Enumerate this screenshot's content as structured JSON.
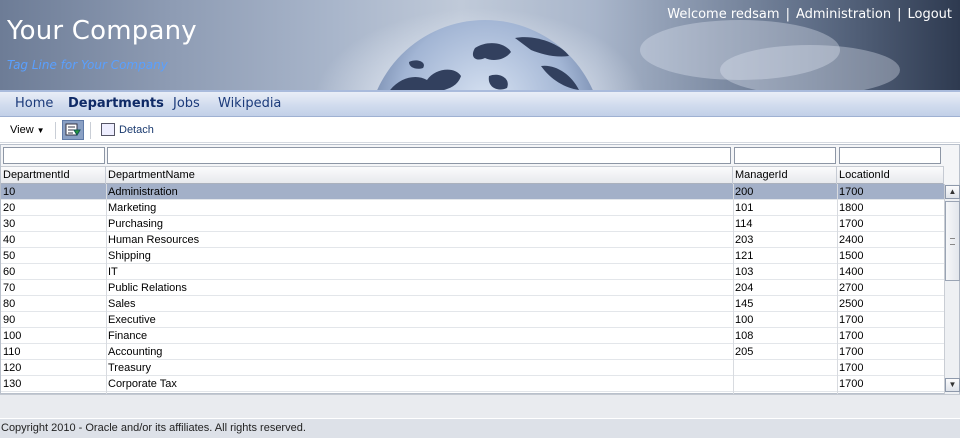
{
  "header": {
    "company_name": "Your Company",
    "tagline": "Tag Line for Your Company",
    "welcome": "Welcome redsam",
    "links": [
      "Administration",
      "Logout"
    ]
  },
  "nav": {
    "tabs": [
      {
        "label": "Home",
        "active": false
      },
      {
        "label": "Departments",
        "active": true
      },
      {
        "label": "Jobs",
        "active": false
      },
      {
        "label": "Wikipedia",
        "active": false
      }
    ]
  },
  "toolbar": {
    "view_label": "View",
    "detach_label": "Detach"
  },
  "table": {
    "columns": [
      "DepartmentId",
      "DepartmentName",
      "ManagerId",
      "LocationId"
    ],
    "filters": [
      "",
      "",
      "",
      ""
    ],
    "selected_row": 0,
    "rows": [
      [
        "10",
        "Administration",
        "200",
        "1700"
      ],
      [
        "20",
        "Marketing",
        "101",
        "1800"
      ],
      [
        "30",
        "Purchasing",
        "114",
        "1700"
      ],
      [
        "40",
        "Human Resources",
        "203",
        "2400"
      ],
      [
        "50",
        "Shipping",
        "121",
        "1500"
      ],
      [
        "60",
        "IT",
        "103",
        "1400"
      ],
      [
        "70",
        "Public Relations",
        "204",
        "2700"
      ],
      [
        "80",
        "Sales",
        "145",
        "2500"
      ],
      [
        "90",
        "Executive",
        "100",
        "1700"
      ],
      [
        "100",
        "Finance",
        "108",
        "1700"
      ],
      [
        "110",
        "Accounting",
        "205",
        "1700"
      ],
      [
        "120",
        "Treasury",
        "",
        "1700"
      ],
      [
        "130",
        "Corporate Tax",
        "",
        "1700"
      ]
    ]
  },
  "footer": {
    "copyright": "Copyright 2010 - Oracle and/or its affiliates. All rights reserved."
  },
  "colors": {
    "selected_row": "#a3b0c8",
    "nav_text": "#1b3a7a",
    "tagline": "#5aa0ff"
  }
}
